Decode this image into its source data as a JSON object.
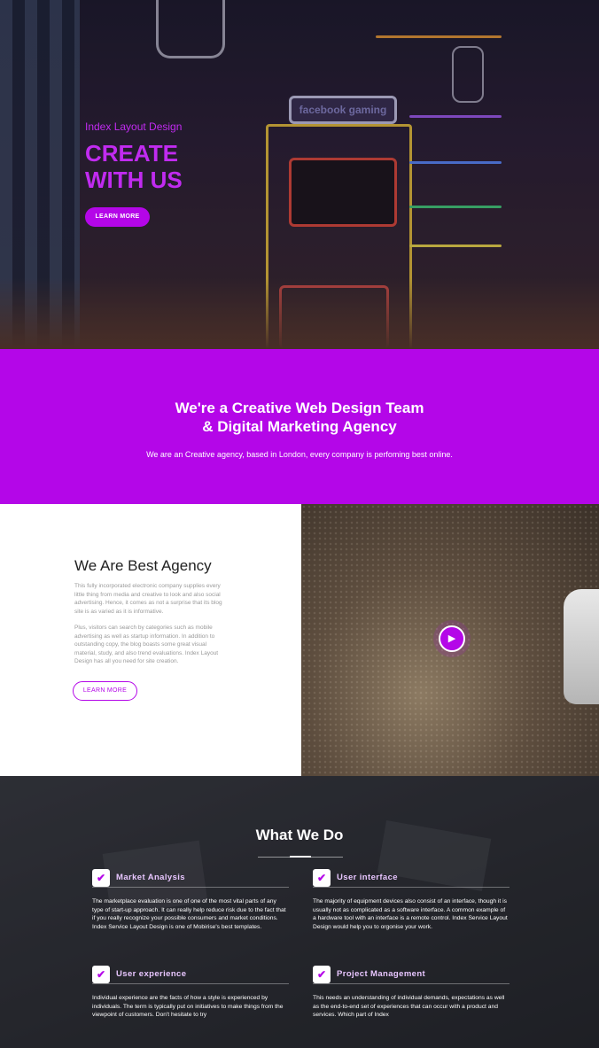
{
  "hero": {
    "kicker": "Index Layout Design",
    "title_line1": "CREATE",
    "title_line2": "WITH US",
    "button": "LEARN MORE",
    "neon_sign": "facebook gaming"
  },
  "band": {
    "heading_line1": "We're a Creative Web Design Team",
    "heading_line2": "& Digital Marketing Agency",
    "subtext": "We are an Creative agency, based in London, every company is perfoming best online."
  },
  "agency": {
    "heading": "We Are Best Agency",
    "paragraph1": "This fully incorporated electronic company supplies every little thing from media and creative to look and also social advertising. Hence, it comes as not a surprise that its blog site is as varied as it is informative.",
    "paragraph2": "Plus, visitors can search by categories such as mobile advertising as well as startup information. In addition to outstanding copy, the blog boasts some great visual material, study, and also trend evaluations. Index Layout Design has all you need for site creation.",
    "button": "LEARN MORE",
    "play_icon": "play-icon"
  },
  "services": {
    "heading": "What We Do",
    "items": [
      {
        "title": "Market Analysis",
        "text": "The marketplace evaluation is one of one of the most vital parts of any type of start-up approach. It can really help reduce risk due to the fact that if you really recognize your possible consumers and market conditions. Index Service Layout Design is one of Mobirise's best templates."
      },
      {
        "title": "User interface",
        "text": "The majority of equipment devices also consist of an interface, though it is usually not as complicated as a software interface. A common example of a hardware tool with an interface is a remote control. Index Service Layout Design would help you to orgonise your work."
      },
      {
        "title": "User experience",
        "text": "Individual experience are the facts of how a style is experienced by individuals. The term is typically put on initiatives to make things from the viewpoint of customers. Don't hesitate to try"
      },
      {
        "title": "Project Management",
        "text": "This needs an understanding of individual demands, expectations as well as the end-to-end set of experiences that can occur with a product and services. Which part of Index"
      }
    ]
  },
  "colors": {
    "accent": "#b406e8",
    "accent_text": "#c12bf0"
  }
}
